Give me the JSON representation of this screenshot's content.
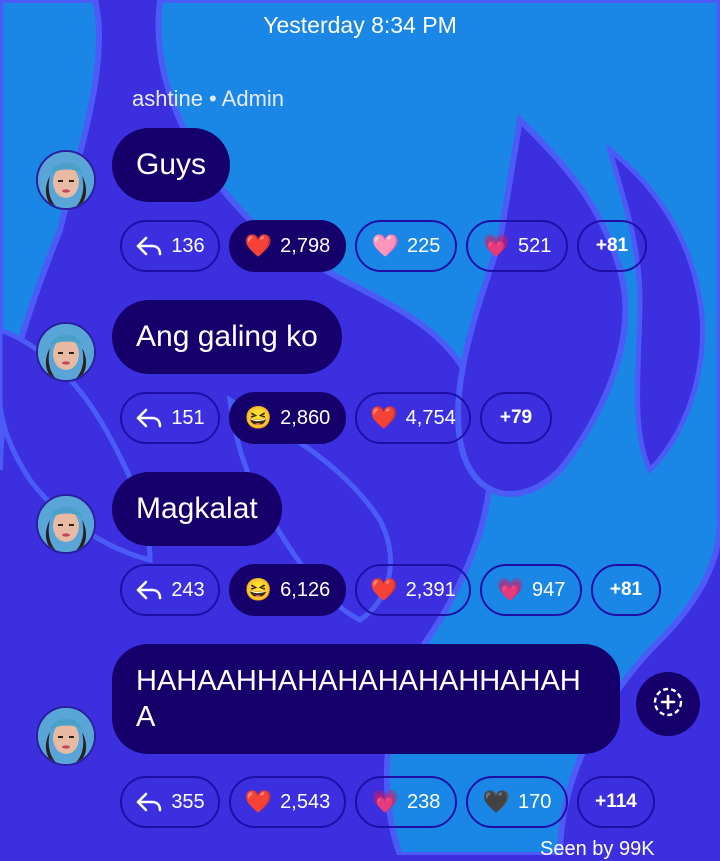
{
  "timestamp": "Yesterday 8:34 PM",
  "sender": "ashtine • Admin",
  "messages": [
    {
      "text": "Guys",
      "reply_count": "136",
      "reactions": [
        {
          "emoji": "❤️",
          "count": "2,798",
          "active": true
        },
        {
          "emoji": "🩷",
          "count": "225",
          "active": false
        },
        {
          "emoji": "💗",
          "count": "521",
          "active": false
        }
      ],
      "more": "+81"
    },
    {
      "text": "Ang galing ko",
      "reply_count": "151",
      "reactions": [
        {
          "emoji": "😆",
          "count": "2,860",
          "active": true
        },
        {
          "emoji": "❤️",
          "count": "4,754",
          "active": false
        }
      ],
      "more": "+79"
    },
    {
      "text": "Magkalat",
      "reply_count": "243",
      "reactions": [
        {
          "emoji": "😆",
          "count": "6,126",
          "active": true
        },
        {
          "emoji": "❤️",
          "count": "2,391",
          "active": false
        },
        {
          "emoji": "💗",
          "count": "947",
          "active": false
        }
      ],
      "more": "+81"
    },
    {
      "text": "HAHAAHHAHAHAHAHAHHAHAHA",
      "reply_count": "355",
      "reactions": [
        {
          "emoji": "❤️",
          "count": "2,543",
          "active": false
        },
        {
          "emoji": "💗",
          "count": "238",
          "active": false
        },
        {
          "emoji": "🖤",
          "count": "170",
          "active": false
        }
      ],
      "more": "+114"
    }
  ],
  "footer_partial": "Seen by 99K",
  "colors": {
    "background": "#3b2fe0",
    "bubble": "#15006b",
    "chip_border": "#1f0fa8",
    "bg_light_blue": "#1a87e6"
  },
  "icons": {
    "reply": "reply-arrow-icon",
    "add_reaction": "add-reaction-icon"
  }
}
